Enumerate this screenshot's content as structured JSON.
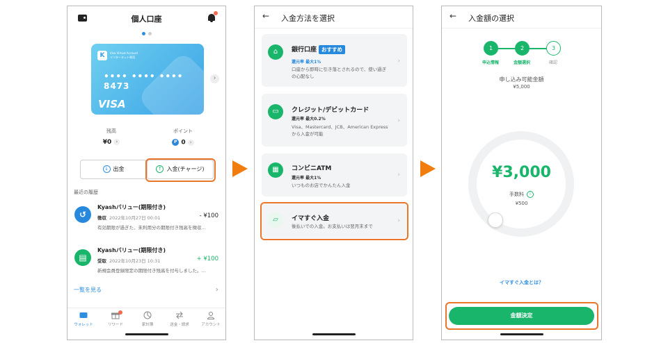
{
  "colors": {
    "accent_green": "#19b56b",
    "highlight_orange": "#e9762b",
    "flow_arrow": "#f07d0e",
    "link_blue": "#2e8fe0",
    "badge_blue": "#2689dd"
  },
  "screen1": {
    "title": "個人口座",
    "card": {
      "brand_small": "Visa Virtual Account",
      "brand_small2": "インターネット専用",
      "number": "•••• •••• •••• 8473",
      "network": "VISA",
      "logo_letter": "K"
    },
    "balance": {
      "label": "残高",
      "value": "¥0"
    },
    "points": {
      "label": "ポイント",
      "value": "0",
      "badge": "P"
    },
    "actions": {
      "withdraw": "出金",
      "charge": "入金(チャージ)"
    },
    "history_label": "最近の履歴",
    "history": [
      {
        "title": "Kyashバリュー(期限付き)",
        "kind": "徴収",
        "date": "2022年10月27日 00:01",
        "amount": "- ¥100",
        "desc": "有効期限が過ぎた、未利用分の期限付き残高を徴収…",
        "icon_color": "#2689dd",
        "amount_color": "#222222"
      },
      {
        "title": "Kyashバリュー(期限付き)",
        "kind": "受取",
        "date": "2022年10月23日 10:31",
        "amount": "+ ¥100",
        "desc": "新規会員登録限定の期限付き残高を付与しました。…",
        "icon_color": "#19b56b",
        "amount_color": "#19b56b"
      }
    ],
    "see_all": "一覧を見る",
    "tabs": [
      {
        "label": "ウォレット",
        "icon": "wallet-icon"
      },
      {
        "label": "リワード",
        "icon": "gift-icon"
      },
      {
        "label": "家計簿",
        "icon": "pie-icon"
      },
      {
        "label": "送金・請求",
        "icon": "transfer-icon"
      },
      {
        "label": "アカウント",
        "icon": "person-icon"
      }
    ]
  },
  "screen2": {
    "title": "入金方法を選択",
    "methods": [
      {
        "title": "銀行口座",
        "badge": "おすすめ",
        "rate": "還元率 最大1%",
        "desc": "口座から即時に引き落とされるので、使い過ぎの心配なし",
        "icon": "bank-icon"
      },
      {
        "title": "クレジット/デビットカード",
        "rate": "還元率 最大0.2%",
        "desc": "Visa、Mastercard、JCB、American Expressから入金が可能",
        "icon": "credit-card-icon"
      },
      {
        "title": "コンビニATM",
        "rate": "還元率 最大1%",
        "desc": "いつものお店でかんたん入金",
        "icon": "atm-icon"
      },
      {
        "title": "イマすぐ入金",
        "desc": "後払いでの入金。お支払いは翌月末まで",
        "icon": "instant-charge-icon"
      }
    ]
  },
  "screen3": {
    "title": "入金額の選択",
    "steps": [
      {
        "num": "1",
        "label": "申込情報"
      },
      {
        "num": "2",
        "label": "金額選択"
      },
      {
        "num": "3",
        "label": "確認"
      }
    ],
    "available_label": "申し込み可能金額",
    "available_value": "¥5,000",
    "amount": "¥3,000",
    "fee_label": "手数料",
    "fee_value": "¥500",
    "link": "イマすぐ入金とは？",
    "cta": "金額決定"
  }
}
